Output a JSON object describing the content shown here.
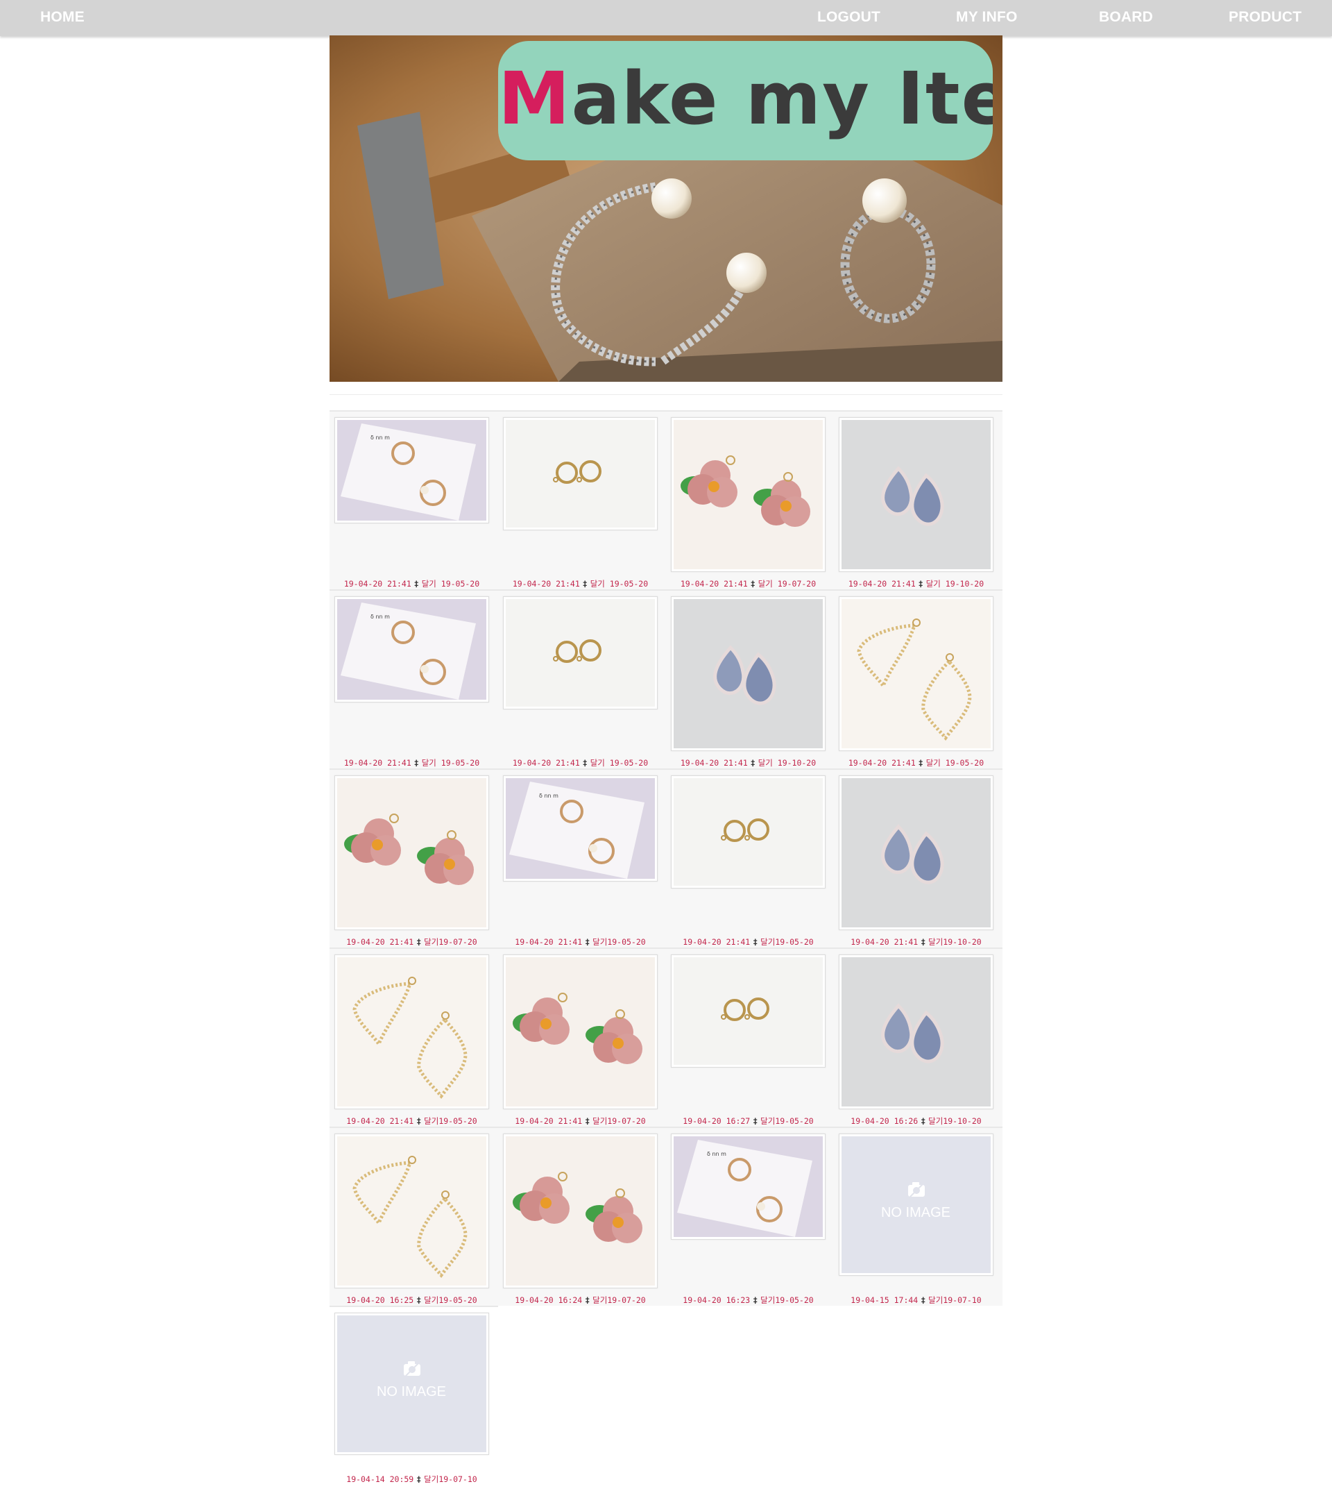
{
  "nav": {
    "home": "HOME",
    "logout": "LOGOUT",
    "my_info": "MY INFO",
    "board": "BOARD",
    "product": "PRODUCT"
  },
  "banner": {
    "brand_first": "M",
    "brand_rest": "ake my Item",
    "badge_color": "#93d4bc",
    "brand_accent": "#d51e5d"
  },
  "products": [
    {
      "img": "rings-card",
      "registered": "19-04-20 21:41",
      "sep": "‡",
      "due": "달기 19-05-20"
    },
    {
      "img": "earrings",
      "registered": "19-04-20 21:41",
      "sep": "‡",
      "due": "달기 19-05-20"
    },
    {
      "img": "flowers",
      "registered": "19-04-20 21:41",
      "sep": "‡",
      "due": "달기 19-07-20"
    },
    {
      "img": "teardrops",
      "registered": "19-04-20 21:41",
      "sep": "‡",
      "due": "달기 19-10-20"
    },
    {
      "img": "rings-card",
      "registered": "19-04-20 21:41",
      "sep": "‡",
      "due": "달기 19-05-20"
    },
    {
      "img": "earrings",
      "registered": "19-04-20 21:41",
      "sep": "‡",
      "due": "달기 19-05-20"
    },
    {
      "img": "teardrops",
      "registered": "19-04-20 21:41",
      "sep": "‡",
      "due": "달기 19-10-20"
    },
    {
      "img": "diamonds",
      "registered": "19-04-20 21:41",
      "sep": "‡",
      "due": "달기 19-05-20"
    },
    {
      "img": "flowers",
      "registered": "19-04-20 21:41",
      "sep": "‡",
      "due": "달기19-07-20"
    },
    {
      "img": "rings-card",
      "registered": "19-04-20 21:41",
      "sep": "‡",
      "due": "달기19-05-20"
    },
    {
      "img": "earrings",
      "registered": "19-04-20 21:41",
      "sep": "‡",
      "due": "달기19-05-20"
    },
    {
      "img": "teardrops",
      "registered": "19-04-20 21:41",
      "sep": "‡",
      "due": "달기19-10-20"
    },
    {
      "img": "diamonds",
      "registered": "19-04-20 21:41",
      "sep": "‡",
      "due": "달기19-05-20"
    },
    {
      "img": "flowers",
      "registered": "19-04-20 21:41",
      "sep": "‡",
      "due": "달기19-07-20"
    },
    {
      "img": "earrings",
      "registered": "19-04-20 16:27",
      "sep": "‡",
      "due": "달기19-05-20"
    },
    {
      "img": "teardrops",
      "registered": "19-04-20 16:26",
      "sep": "‡",
      "due": "달기19-10-20"
    },
    {
      "img": "diamonds",
      "registered": "19-04-20 16:25",
      "sep": "‡",
      "due": "달기19-05-20"
    },
    {
      "img": "flowers",
      "registered": "19-04-20 16:24",
      "sep": "‡",
      "due": "달기19-07-20"
    },
    {
      "img": "rings-card",
      "registered": "19-04-20 16:23",
      "sep": "‡",
      "due": "달기19-05-20"
    },
    {
      "img": "no-image",
      "registered": "19-04-15 17:44",
      "sep": "‡",
      "due": "달기19-07-10",
      "placeholder": "NO IMAGE"
    },
    {
      "img": "no-image",
      "registered": "19-04-14 20:59",
      "sep": "‡",
      "due": "달기19-07-10",
      "placeholder": "NO IMAGE"
    }
  ]
}
